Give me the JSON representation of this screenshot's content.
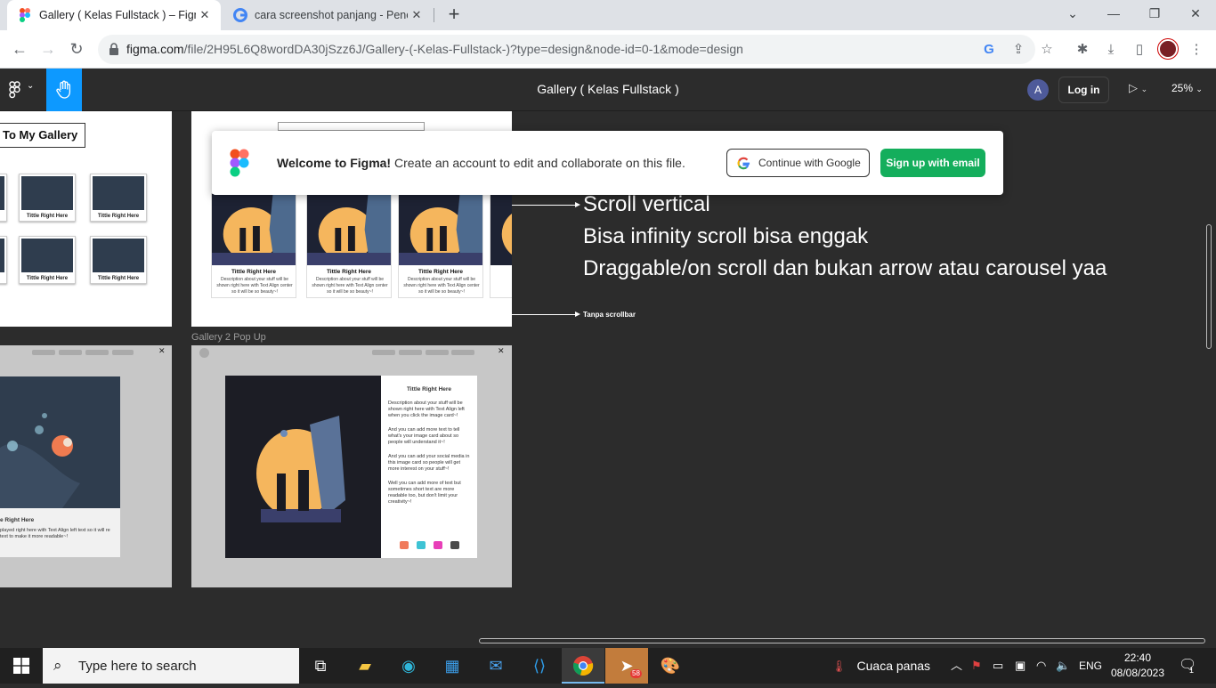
{
  "browser": {
    "tabs": [
      {
        "title": "Gallery ( Kelas Fullstack ) – Figma",
        "active": true
      },
      {
        "title": "cara screenshot panjang - Penelu",
        "active": false
      }
    ],
    "url_main": "figma.com",
    "url_rest": "/file/2H95L6Q8wordDA30jSzz6J/Gallery-(-Kelas-Fullstack-)?type=design&node-id=0-1&mode=design"
  },
  "figma": {
    "file_title": "Gallery ( Kelas Fullstack )",
    "user_initial": "A",
    "login_label": "Log in",
    "zoom": "25%"
  },
  "banner": {
    "bold": "Welcome to Figma!",
    "text": " Create an account to edit and collaborate on this file.",
    "google_label": "Continue with Google",
    "signup_label": "Sign up with email"
  },
  "canvas": {
    "gallery_heading": "To My Gallery",
    "mini_caption": "Tittle Right Here",
    "card_title": "Tittle Right Here",
    "card_desc": "Description about your stuff will be shown right here with Text Align center so it will be so beauty~!",
    "frame_label_popup2": "Gallery 2 Pop Up",
    "notes": {
      "line1": "Scroll vertical",
      "line2": "Bisa infinity scroll bisa enggak",
      "line3": "Draggable/on scroll dan bukan arrow atau carousel yaa",
      "small": "Tanpa scrollbar"
    },
    "popup1": {
      "title": "e Right Here",
      "desc": "played right here with Text Align left text so it will re text to make it more readable~!"
    },
    "popup2": {
      "title": "Tittle Right Here",
      "p1": "Description about your stuff will be shown right here with Text Align left when you click the image card~!",
      "p2": "And you can add more text to tell what's your image card about so people will understand it~!",
      "p3": "And you can add your social media in this image card so people will get more interest on your stuff~!",
      "p4": "Well you can add more of text but sometimes short text are more readable too, but don't limit your creativity~!",
      "swatch_colors": [
        "#f07a5b",
        "#3ec3d4",
        "#e83fb8",
        "#4b4b4b"
      ]
    }
  },
  "taskbar": {
    "search_placeholder": "Type here to search",
    "weather": "Cuaca panas",
    "lang": "ENG",
    "time": "22:40",
    "date": "08/08/2023",
    "telegram_badge": "58",
    "notif_count": "1"
  }
}
